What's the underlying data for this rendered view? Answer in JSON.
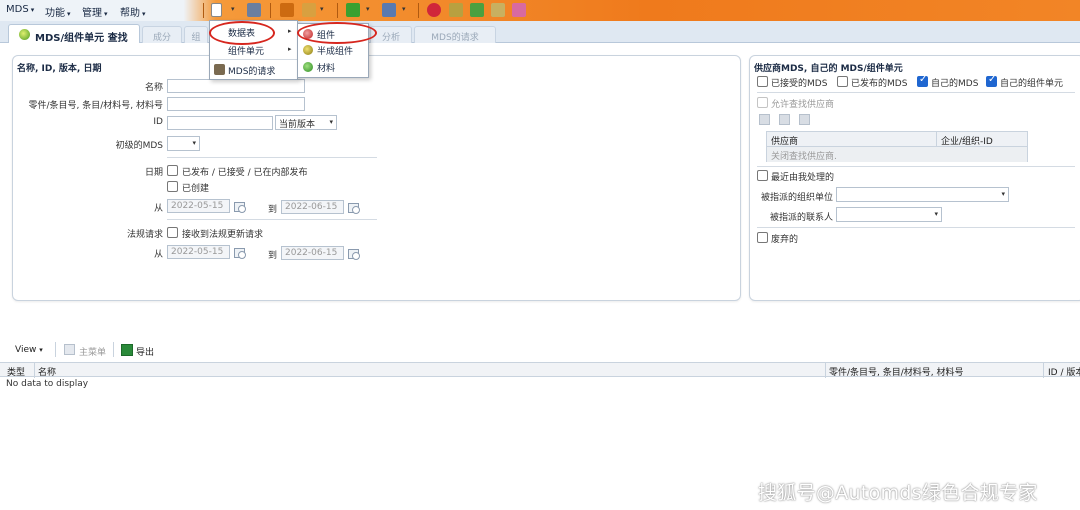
{
  "menubar": {
    "items": [
      {
        "label": "MDS"
      },
      {
        "label": "功能"
      },
      {
        "label": "管理"
      },
      {
        "label": "帮助"
      }
    ],
    "toolbar_icons": [
      "new-document-icon",
      "save-icon",
      "flag-icon",
      "chart-icon",
      "download-icon",
      "upload-icon",
      "settings-icon",
      "tools-icon",
      "network-icon",
      "hand-icon",
      "flask-icon"
    ]
  },
  "tabs": {
    "active": "MDS/组件单元 查找",
    "inactive": [
      "成分",
      "组",
      "分析",
      "MDS的请求"
    ]
  },
  "new_menu": {
    "items": [
      "数据表",
      "组件单元",
      "MDS的请求"
    ],
    "submenu": [
      "组件",
      "半成组件",
      "材料"
    ]
  },
  "left_panel": {
    "title": "名称, ID, 版本, 日期",
    "name_label": "名称",
    "part_label": "零件/条目号, 条目/材料号, 材料号",
    "id_label": "ID",
    "version_select": "当前版本",
    "initial_mds_label": "初级的MDS",
    "date_label": "日期",
    "date_cb1": "已发布 / 已接受 / 已在内部发布",
    "date_cb2": "已创建",
    "from_label": "从",
    "to_label": "到",
    "date_from": "2022-05-15",
    "date_to": "2022-06-15",
    "reg_label": "法规请求",
    "reg_cb": "接收到法规更新请求",
    "reg_from": "2022-05-15",
    "reg_to": "2022-06-15"
  },
  "right_panel": {
    "title": "供应商MDS, 自己的 MDS/组件单元",
    "cb_accepted": "已接受的MDS",
    "cb_published": "已发布的MDS",
    "cb_own_mds": "自己的MDS",
    "cb_own_component": "自己的组件单元",
    "allow_supplier": "允许查找供应商",
    "table_col1": "供应商",
    "table_col2": "企业/组织-ID",
    "table_row": "关闭查找供应商.",
    "recent_processed": "最近由我处理的",
    "assigned_org": "被指派的组织单位",
    "assigned_contact": "被指派的联系人",
    "discarded": "废弃的"
  },
  "result_toolbar": {
    "view": "View",
    "main_menu": "主菜单",
    "export": "导出"
  },
  "grid": {
    "columns": [
      "类型",
      "名称",
      "零件/条目号, 条目/材料号, 材料号",
      "ID / 版本"
    ],
    "empty": "No data to display"
  },
  "watermark": "搜狐号@Automds绿色合规专家"
}
